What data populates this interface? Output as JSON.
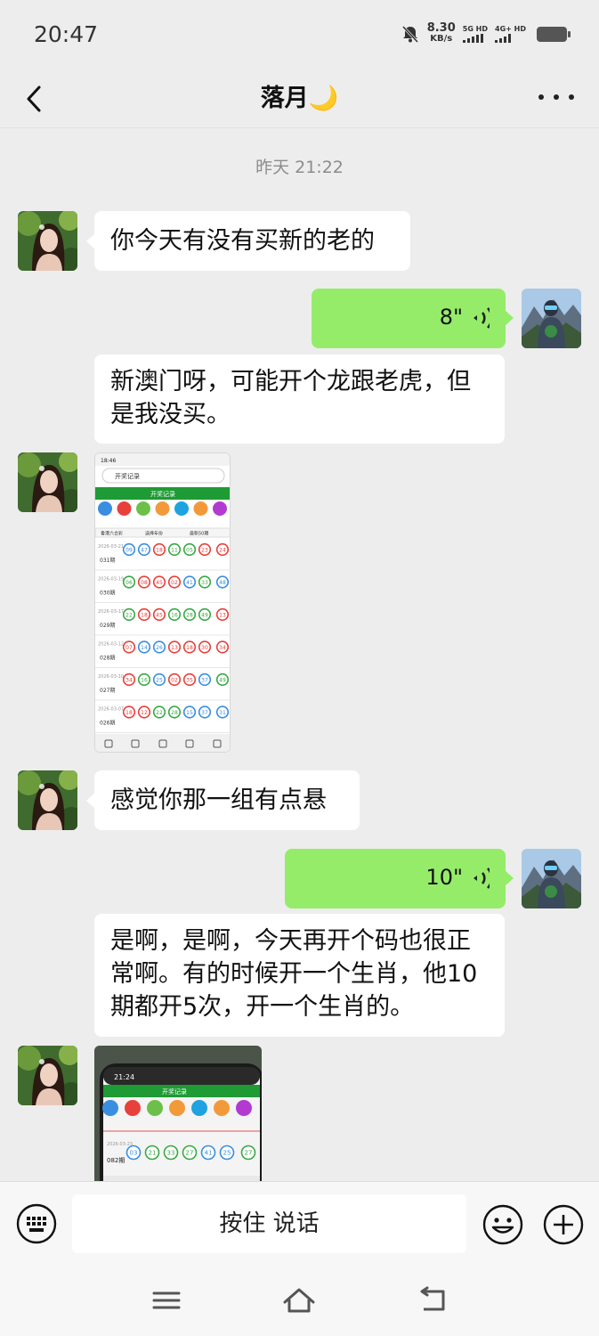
{
  "status_bar": {
    "time": "20:47",
    "net_speed_value": "8.30",
    "net_speed_unit": "KB/s",
    "sim1": "5G HD",
    "sim2": "4G+ HD"
  },
  "header": {
    "title": "落月🌙"
  },
  "chat": {
    "timestamp": "昨天 21:22",
    "messages": [
      {
        "direction": "in",
        "type": "text",
        "text": "你今天有没有买新的老的"
      },
      {
        "direction": "out",
        "type": "voice",
        "duration": "8\"",
        "transcript": "新澳门呀，可能开个龙跟老虎，但是我没买。"
      },
      {
        "direction": "in",
        "type": "image"
      },
      {
        "direction": "in",
        "type": "text",
        "text": "感觉你那一组有点悬"
      },
      {
        "direction": "out",
        "type": "voice",
        "duration": "10\"",
        "transcript": "是啊，是啊，今天再开个码也很正常啊。有的时候开一个生肖，他10期都开5次，开一个生肖的。"
      },
      {
        "direction": "in",
        "type": "image"
      }
    ]
  },
  "screenshot1": {
    "time": "18:46",
    "search": "开奖记录",
    "page_title": "开奖记录",
    "filters": [
      "香港六合彩",
      "选择年份",
      "最新50期"
    ],
    "rows": [
      {
        "date": "2026-03-21",
        "issue": "031期",
        "nums": [
          "09",
          "47",
          "18",
          "11",
          "05",
          "23",
          "24"
        ],
        "colors": [
          "blue",
          "blue",
          "red",
          "green",
          "green",
          "red",
          "red"
        ]
      },
      {
        "date": "2026-03-19",
        "issue": "030期",
        "nums": [
          "06",
          "08",
          "45",
          "02",
          "41",
          "33",
          "48"
        ],
        "colors": [
          "green",
          "red",
          "red",
          "red",
          "blue",
          "green",
          "blue"
        ]
      },
      {
        "date": "2026-03-17",
        "issue": "029期",
        "nums": [
          "22",
          "18",
          "45",
          "16",
          "28",
          "49",
          "13"
        ],
        "colors": [
          "green",
          "red",
          "red",
          "green",
          "green",
          "green",
          "red"
        ]
      },
      {
        "date": "2026-03-12",
        "issue": "028期",
        "nums": [
          "07",
          "14",
          "26",
          "13",
          "18",
          "30",
          "34"
        ],
        "colors": [
          "red",
          "blue",
          "blue",
          "red",
          "red",
          "red",
          "red"
        ]
      },
      {
        "date": "2026-03-10",
        "issue": "027期",
        "nums": [
          "34",
          "16",
          "25",
          "02",
          "35",
          "37",
          "49"
        ],
        "colors": [
          "red",
          "green",
          "blue",
          "red",
          "red",
          "blue",
          "green"
        ]
      },
      {
        "date": "2026-03-07",
        "issue": "026期",
        "nums": [
          "18",
          "12",
          "22",
          "28",
          "15",
          "37",
          "31"
        ],
        "colors": [
          "red",
          "red",
          "green",
          "green",
          "blue",
          "blue",
          "blue"
        ]
      }
    ]
  },
  "screenshot2": {
    "time": "21:24",
    "page_title": "开奖记录",
    "date": "2026-03-23",
    "issue": "082期",
    "nums": [
      "03",
      "21",
      "33",
      "27",
      "41",
      "25",
      "27"
    ],
    "colors": [
      "blue",
      "green",
      "green",
      "green",
      "blue",
      "blue",
      "green"
    ]
  },
  "input_bar": {
    "hold_to_talk": "按住 说话"
  },
  "colors": {
    "background": "#ededed",
    "outgoing_bubble": "#95ec69",
    "incoming_bubble": "#ffffff",
    "ball_red": "#e8403b",
    "ball_blue": "#3a8ee0",
    "ball_green": "#39a845"
  },
  "icons": {
    "back": "back-arrow-icon",
    "more": "more-dots-icon",
    "voice": "voice-wave-icon",
    "keyboard": "keyboard-icon",
    "emoji": "emoji-icon",
    "plus": "plus-icon"
  }
}
